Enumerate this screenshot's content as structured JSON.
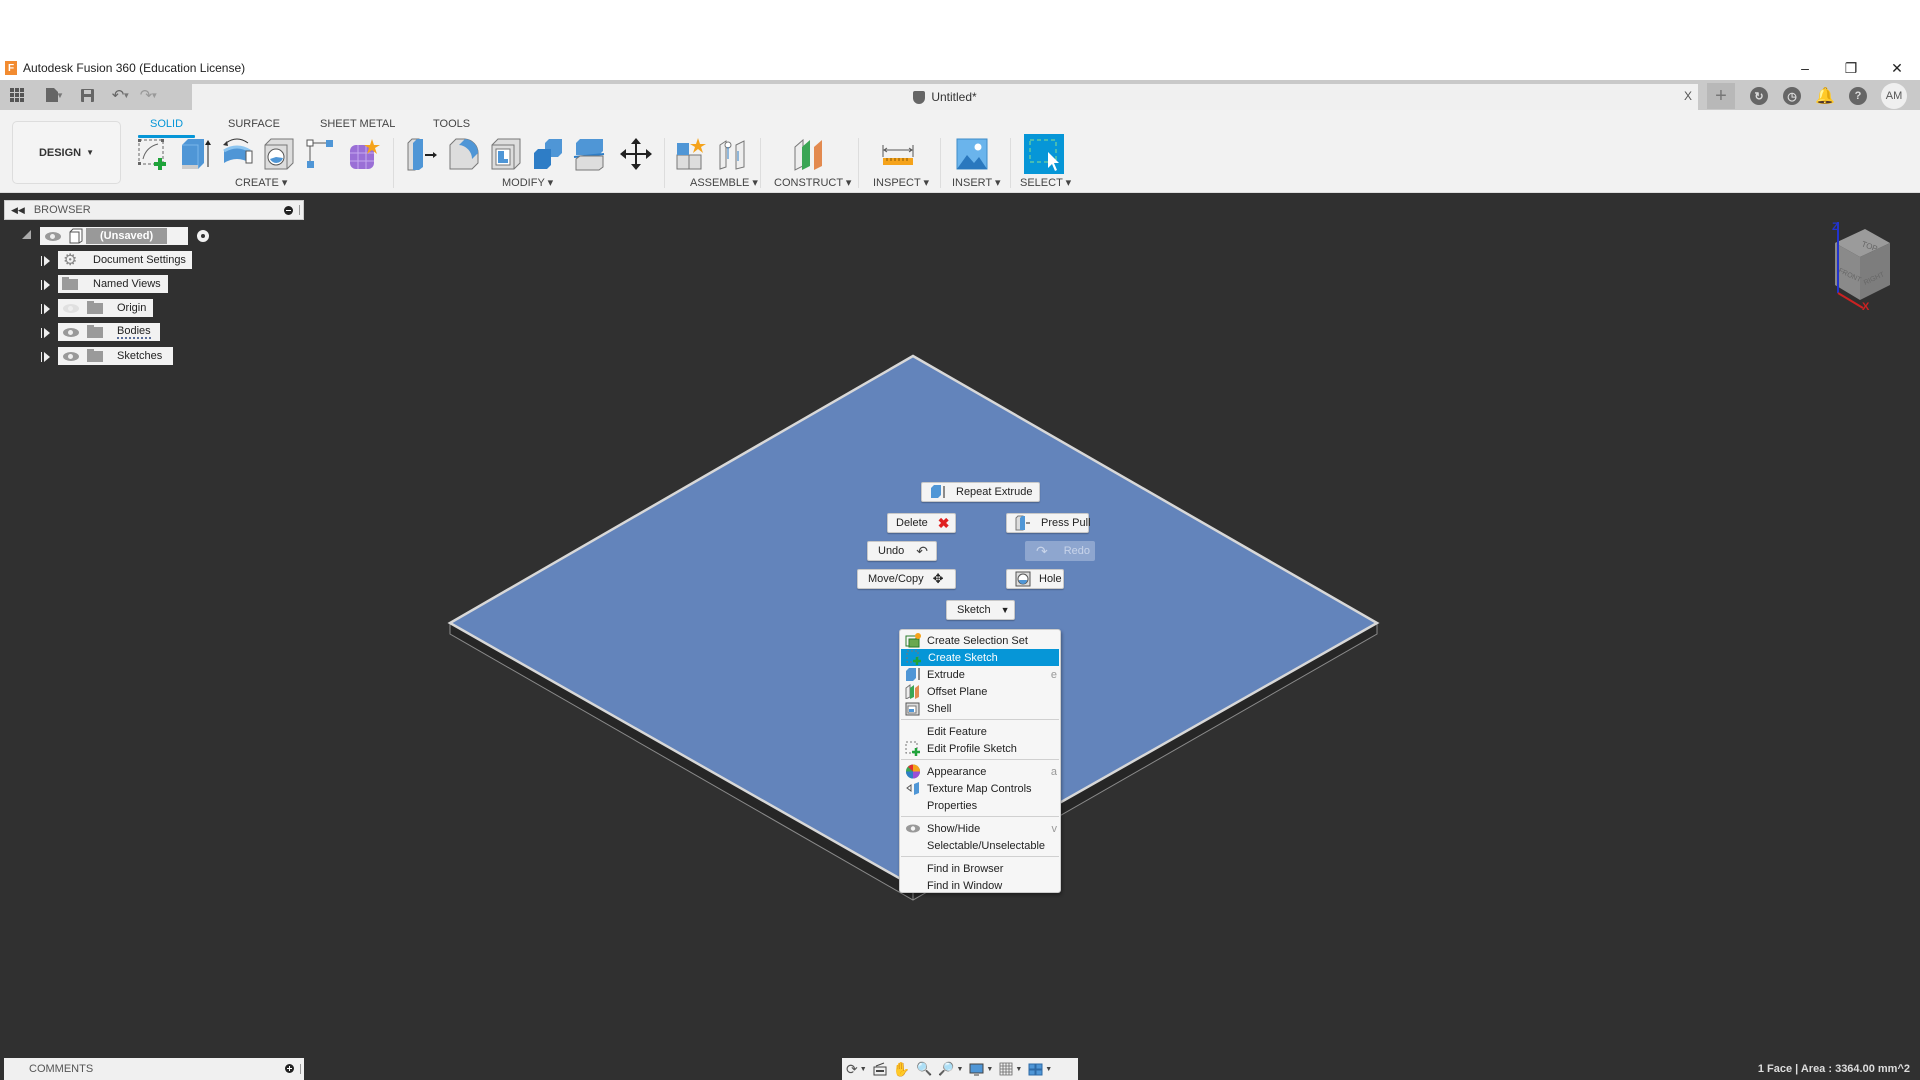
{
  "window": {
    "title": "Autodesk Fusion 360 (Education License)",
    "controls": [
      "minimize",
      "restore",
      "close"
    ]
  },
  "quick_access": {
    "icons": [
      "apps-grid-icon",
      "file-icon",
      "save-icon",
      "undo-icon",
      "redo-icon"
    ],
    "document_tab": {
      "name": "Untitled*",
      "close": "X"
    },
    "right_icons": [
      "new-tab",
      "extensions",
      "job-status",
      "notifications",
      "help"
    ],
    "user_initials": "AM"
  },
  "ribbon": {
    "workspace": "DESIGN",
    "tabs": [
      {
        "label": "SOLID",
        "active": true
      },
      {
        "label": "SURFACE",
        "active": false
      },
      {
        "label": "SHEET METAL",
        "active": false
      },
      {
        "label": "TOOLS",
        "active": false
      }
    ],
    "groups": [
      {
        "label": "CREATE",
        "tools": [
          "Create Sketch",
          "Extrude",
          "Revolve",
          "Hole",
          "Pattern",
          "Create Form"
        ]
      },
      {
        "label": "MODIFY",
        "tools": [
          "Press Pull",
          "Fillet",
          "Shell",
          "Combine",
          "Split Body",
          "Move/Copy"
        ]
      },
      {
        "label": "ASSEMBLE",
        "tools": [
          "New Component",
          "Joint"
        ]
      },
      {
        "label": "CONSTRUCT",
        "tools": [
          "Offset Plane"
        ]
      },
      {
        "label": "INSPECT",
        "tools": [
          "Measure"
        ]
      },
      {
        "label": "INSERT",
        "tools": [
          "Insert Image"
        ]
      },
      {
        "label": "SELECT",
        "tools": [
          "Select"
        ]
      }
    ],
    "accent_color": "#0696d7"
  },
  "browser": {
    "title": "BROWSER",
    "root": {
      "label": "(Unsaved)"
    },
    "items": [
      {
        "label": "Document Settings",
        "icon": "gear"
      },
      {
        "label": "Named Views",
        "icon": "folder"
      },
      {
        "label": "Origin",
        "icon": "folder",
        "visible": false
      },
      {
        "label": "Bodies",
        "icon": "folder",
        "visible": true
      },
      {
        "label": "Sketches",
        "icon": "folder",
        "visible": true
      }
    ]
  },
  "viewcube": {
    "faces": [
      "TOP",
      "FRONT",
      "RIGHT"
    ],
    "axes": [
      "Z",
      "X"
    ]
  },
  "marking_menu": {
    "repeat": "Repeat Extrude",
    "delete": "Delete",
    "press_pull": "Press Pull",
    "undo": "Undo",
    "redo": "Redo",
    "move_copy": "Move/Copy",
    "hole": "Hole",
    "sketch": "Sketch"
  },
  "context_menu": {
    "groups": [
      [
        {
          "label": "Create Selection Set",
          "icon": "selection-set",
          "shortcut": ""
        },
        {
          "label": "Create Sketch",
          "icon": "sketch",
          "shortcut": "",
          "highlighted": true
        },
        {
          "label": "Extrude",
          "icon": "extrude",
          "shortcut": "e"
        },
        {
          "label": "Offset Plane",
          "icon": "offset-plane",
          "shortcut": ""
        },
        {
          "label": "Shell",
          "icon": "shell",
          "shortcut": ""
        }
      ],
      [
        {
          "label": "Edit Feature",
          "icon": "",
          "shortcut": ""
        },
        {
          "label": "Edit Profile Sketch",
          "icon": "sketch",
          "shortcut": ""
        }
      ],
      [
        {
          "label": "Appearance",
          "icon": "appearance",
          "shortcut": "a"
        },
        {
          "label": "Texture Map Controls",
          "icon": "texture",
          "shortcut": ""
        },
        {
          "label": "Properties",
          "icon": "",
          "shortcut": ""
        }
      ],
      [
        {
          "label": "Show/Hide",
          "icon": "eye",
          "shortcut": "v"
        },
        {
          "label": "Selectable/Unselectable",
          "icon": "",
          "shortcut": ""
        }
      ],
      [
        {
          "label": "Find in Browser",
          "icon": "",
          "shortcut": ""
        },
        {
          "label": "Find in Window",
          "icon": "",
          "shortcut": ""
        }
      ]
    ]
  },
  "comments": {
    "title": "COMMENTS"
  },
  "nav_bar": {
    "tools": [
      "orbit",
      "look-at",
      "pan",
      "zoom",
      "fit",
      "display-settings",
      "grid",
      "viewports"
    ]
  },
  "status": {
    "text": "1 Face | Area : 3364.00 mm^2"
  },
  "colors": {
    "canvas": "#303030",
    "face": "#6384bb",
    "highlight": "#0696d7"
  }
}
